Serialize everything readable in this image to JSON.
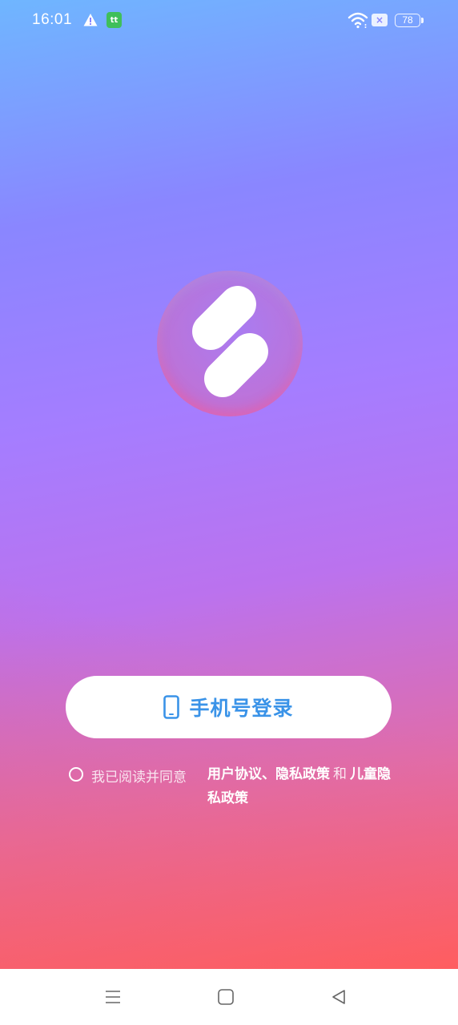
{
  "status_bar": {
    "time": "16:01",
    "notification_icon_label": "tt",
    "sim_icon_label": "×",
    "battery_level": "78"
  },
  "logo": {
    "icon": "app-logo-icon"
  },
  "login": {
    "button_label": "手机号登录",
    "icon": "phone-icon"
  },
  "agreement": {
    "prefix": "我已阅读并同意",
    "user_agreement": "用户协议",
    "separator": "、",
    "privacy_policy": "隐私政策",
    "conjunction": "和",
    "children_privacy_policy": "儿童隐私政策"
  },
  "colors": {
    "accent": "#3a93e8",
    "gradient_top": "#6fb6ff",
    "gradient_bottom": "#ff5e63"
  }
}
